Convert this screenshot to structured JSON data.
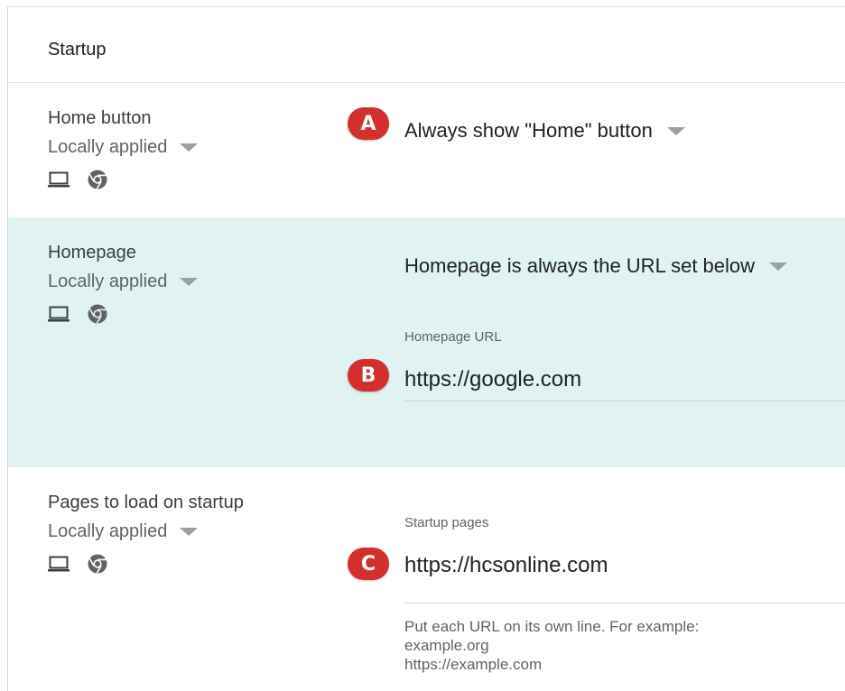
{
  "header": {
    "title": "Startup"
  },
  "sections": [
    {
      "name": "Home button",
      "applied": "Locally applied",
      "badge": "A",
      "value": "Always show \"Home\" button"
    },
    {
      "name": "Homepage",
      "applied": "Locally applied",
      "value": "Homepage is always the URL set below",
      "field_label": "Homepage URL",
      "badge": "B",
      "field_value": "https://google.com"
    },
    {
      "name": "Pages to load on startup",
      "applied": "Locally applied",
      "field_label": "Startup pages",
      "badge": "C",
      "field_value": "https://hcsonline.com",
      "help_lines": [
        "Put each URL on its own line. For example:",
        "example.org",
        "https://example.com"
      ]
    }
  ],
  "icons": [
    "laptop-icon",
    "chrome-icon",
    "dropdown-caret-icon"
  ],
  "colors": {
    "highlight_bg": "#e0f2f1",
    "badge": "#d32f2f"
  }
}
